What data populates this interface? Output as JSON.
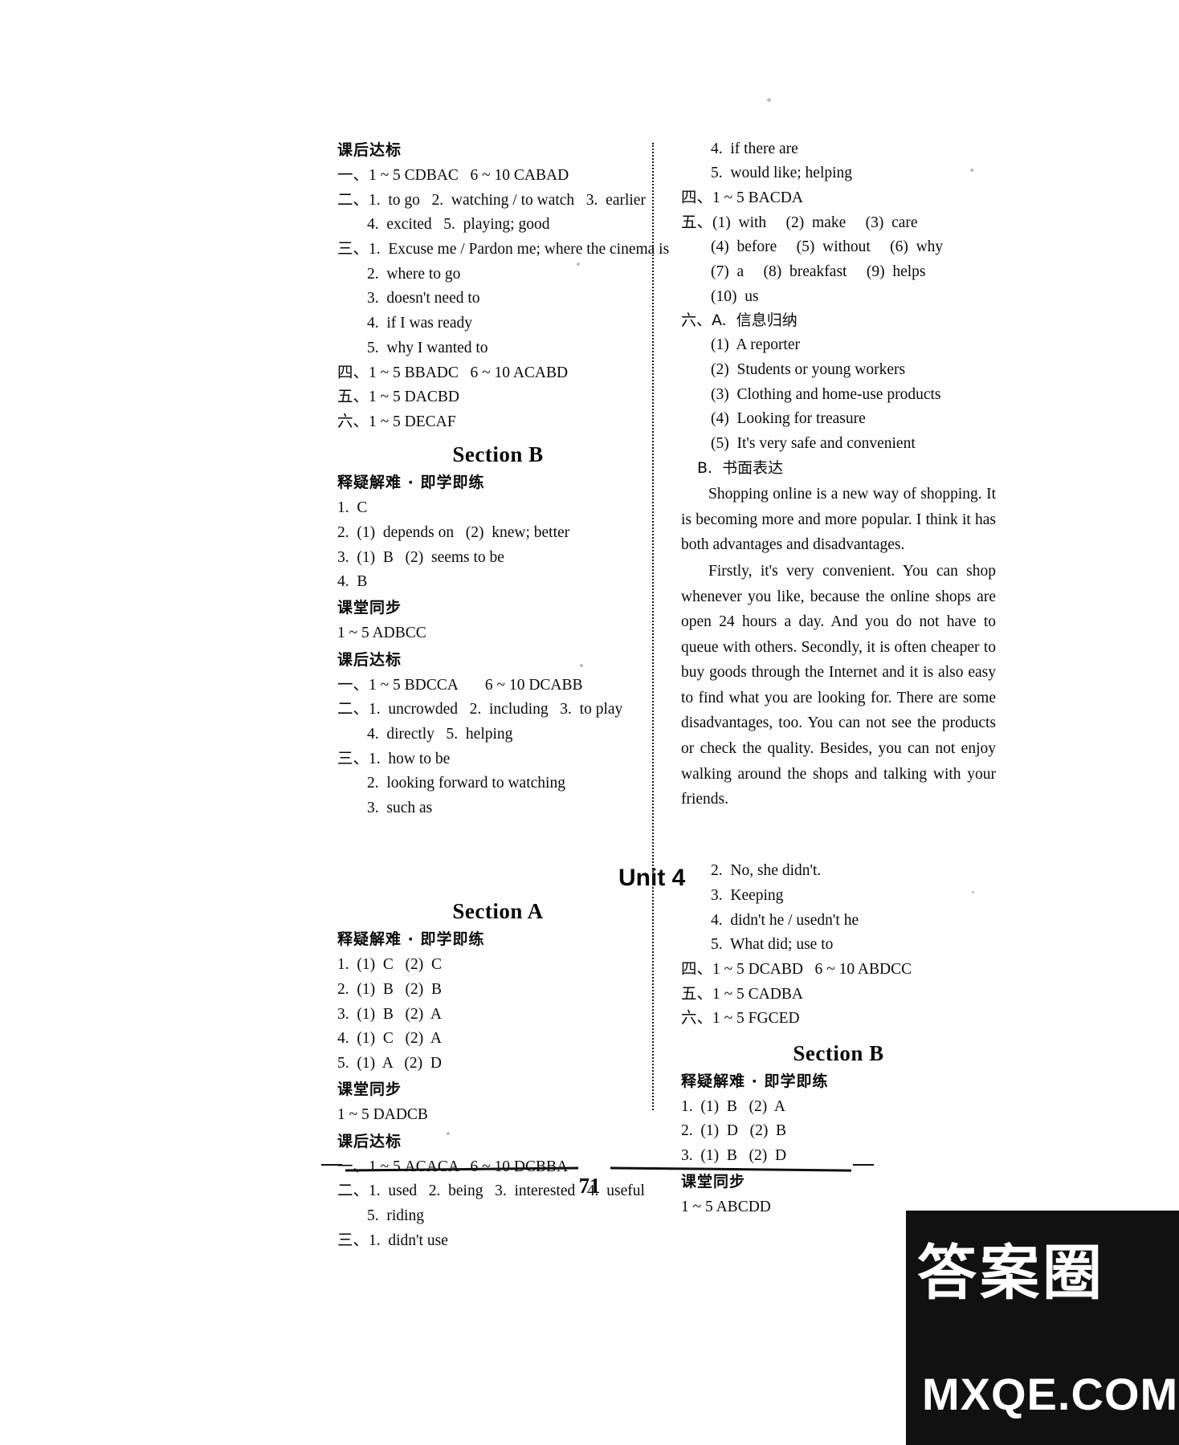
{
  "page": {
    "number": "71",
    "watermark_cn": "答案圈",
    "watermark_url": "MXQE.COM"
  },
  "headings": {
    "unit4": "Unit 4",
    "section_a": "Section A",
    "section_b": "Section B",
    "kehou_dabiao": "课后达标",
    "shiyi_jielan": "释疑解难 · 即学即练",
    "ketang_tongbu": "课堂同步",
    "xinxi_guina": "六、A.  信息归纳",
    "shumian_biaoda": "B.  书面表达"
  },
  "left_column": {
    "block1": {
      "title": "课后达标",
      "lines": [
        {
          "text": "一、1 ~ 5 CDBAC   6 ~ 10 CABAD",
          "indent": 0
        },
        {
          "text": "二、1.  to go   2.  watching / to watch   3.  earlier",
          "indent": 0
        },
        {
          "text": "4.  excited   5.  playing; good",
          "indent": 1
        },
        {
          "text": "三、1.  Excuse me / Pardon me; where the cinema is",
          "indent": 0
        },
        {
          "text": "2.  where to go",
          "indent": 1
        },
        {
          "text": "3.  doesn't need to",
          "indent": 1
        },
        {
          "text": "4.  if I was ready",
          "indent": 1
        },
        {
          "text": "5.  why I wanted to",
          "indent": 1
        },
        {
          "text": "四、1 ~ 5 BBADC   6 ~ 10 ACABD",
          "indent": 0
        },
        {
          "text": "五、1 ~ 5 DACBD",
          "indent": 0
        },
        {
          "text": "六、1 ~ 5 DECAF",
          "indent": 0
        }
      ]
    },
    "section_b_heading": "Section B",
    "block2": {
      "title": "释疑解难 · 即学即练",
      "lines": [
        {
          "text": "1.  C",
          "indent": 0
        },
        {
          "text": "2.  (1)  depends on   (2)  knew; better",
          "indent": 0
        },
        {
          "text": "3.  (1)  B   (2)  seems to be",
          "indent": 0
        },
        {
          "text": "4.  B",
          "indent": 0
        }
      ]
    },
    "block3": {
      "title": "课堂同步",
      "lines": [
        {
          "text": "1 ~ 5 ADBCC",
          "indent": 0
        }
      ]
    },
    "block4": {
      "title": "课后达标",
      "lines": [
        {
          "text": "一、1 ~ 5 BDCCA       6 ~ 10 DCABB",
          "indent": 0
        },
        {
          "text": "二、1.  uncrowded   2.  including   3.  to play",
          "indent": 0
        },
        {
          "text": "4.  directly   5.  helping",
          "indent": 1
        },
        {
          "text": "三、1.  how to be",
          "indent": 0
        },
        {
          "text": "2.  looking forward to watching",
          "indent": 1
        },
        {
          "text": "3.  such as",
          "indent": 1
        }
      ]
    },
    "unit4_section_a_heading": "Section A",
    "block5": {
      "title": "释疑解难 · 即学即练",
      "lines": [
        {
          "text": "1.  (1)  C   (2)  C",
          "indent": 0
        },
        {
          "text": "2.  (1)  B   (2)  B",
          "indent": 0
        },
        {
          "text": "3.  (1)  B   (2)  A",
          "indent": 0
        },
        {
          "text": "4.  (1)  C   (2)  A",
          "indent": 0
        },
        {
          "text": "5.  (1)  A   (2)  D",
          "indent": 0
        }
      ]
    },
    "block6": {
      "title": "课堂同步",
      "lines": [
        {
          "text": "1 ~ 5 DADCB",
          "indent": 0
        }
      ]
    },
    "block7": {
      "title": "课后达标",
      "lines": [
        {
          "text": "一、1 ~ 5 ACACA   6 ~ 10 DCBBA",
          "indent": 0
        },
        {
          "text": "二、1.  used   2.  being   3.  interested   4.  useful",
          "indent": 0
        },
        {
          "text": "5.  riding",
          "indent": 1
        },
        {
          "text": "三、1.  didn't use",
          "indent": 0
        }
      ]
    }
  },
  "right_column": {
    "block1": {
      "lines": [
        {
          "text": "4.  if there are",
          "indent": 1
        },
        {
          "text": "5.  would like; helping",
          "indent": 1
        },
        {
          "text": "四、1 ~ 5 BACDA",
          "indent": 0
        },
        {
          "text": "五、(1)  with     (2)  make     (3)  care",
          "indent": 0
        },
        {
          "text": "(4)  before     (5)  without     (6)  why",
          "indent": 1
        },
        {
          "text": "(7)  a     (8)  breakfast     (9)  helps",
          "indent": 1
        },
        {
          "text": "(10)  us",
          "indent": 1
        }
      ]
    },
    "reading_title": "六、A.  信息归纳",
    "reading_items": [
      {
        "text": "(1)  A reporter",
        "indent": 1
      },
      {
        "text": "(2)  Students or young workers",
        "indent": 1
      },
      {
        "text": "(3)  Clothing and home-use products",
        "indent": 1
      },
      {
        "text": "(4)  Looking for treasure",
        "indent": 1
      },
      {
        "text": "(5)  It's very safe and convenient",
        "indent": 1
      }
    ],
    "writing_title": "B.  书面表达",
    "writing_paragraphs": [
      "Shopping online is a new way of shopping. It is becoming more and more popular. I think it has both advantages and disadvantages.",
      "Firstly, it's very convenient. You can shop whenever you like, because the online shops are open 24 hours a day. And you do not have to queue with others. Secondly, it is often cheaper to buy goods through the Internet and it is also easy to find what you are looking for. There are some disadvantages, too. You can not see the products or check the quality. Besides, you can not enjoy walking around the shops and talking with your friends."
    ],
    "unit4_block1": {
      "lines": [
        {
          "text": "2.  No, she didn't.",
          "indent": 1
        },
        {
          "text": "3.  Keeping",
          "indent": 1
        },
        {
          "text": "4.  didn't he / usedn't he",
          "indent": 1
        },
        {
          "text": "5.  What did; use to",
          "indent": 1
        },
        {
          "text": "四、1 ~ 5 DCABD   6 ~ 10 ABDCC",
          "indent": 0
        },
        {
          "text": "五、1 ~ 5 CADBA",
          "indent": 0
        },
        {
          "text": "六、1 ~ 5 FGCED",
          "indent": 0
        }
      ]
    },
    "section_b_heading": "Section B",
    "block_sb": {
      "title": "释疑解难 · 即学即练",
      "lines": [
        {
          "text": "1.  (1)  B   (2)  A",
          "indent": 0
        },
        {
          "text": "2.  (1)  D   (2)  B",
          "indent": 0
        },
        {
          "text": "3.  (1)  B   (2)  D",
          "indent": 0
        }
      ]
    },
    "block_kt": {
      "title": "课堂同步",
      "lines": [
        {
          "text": "1 ~ 5 ABCDD",
          "indent": 0
        }
      ]
    }
  }
}
